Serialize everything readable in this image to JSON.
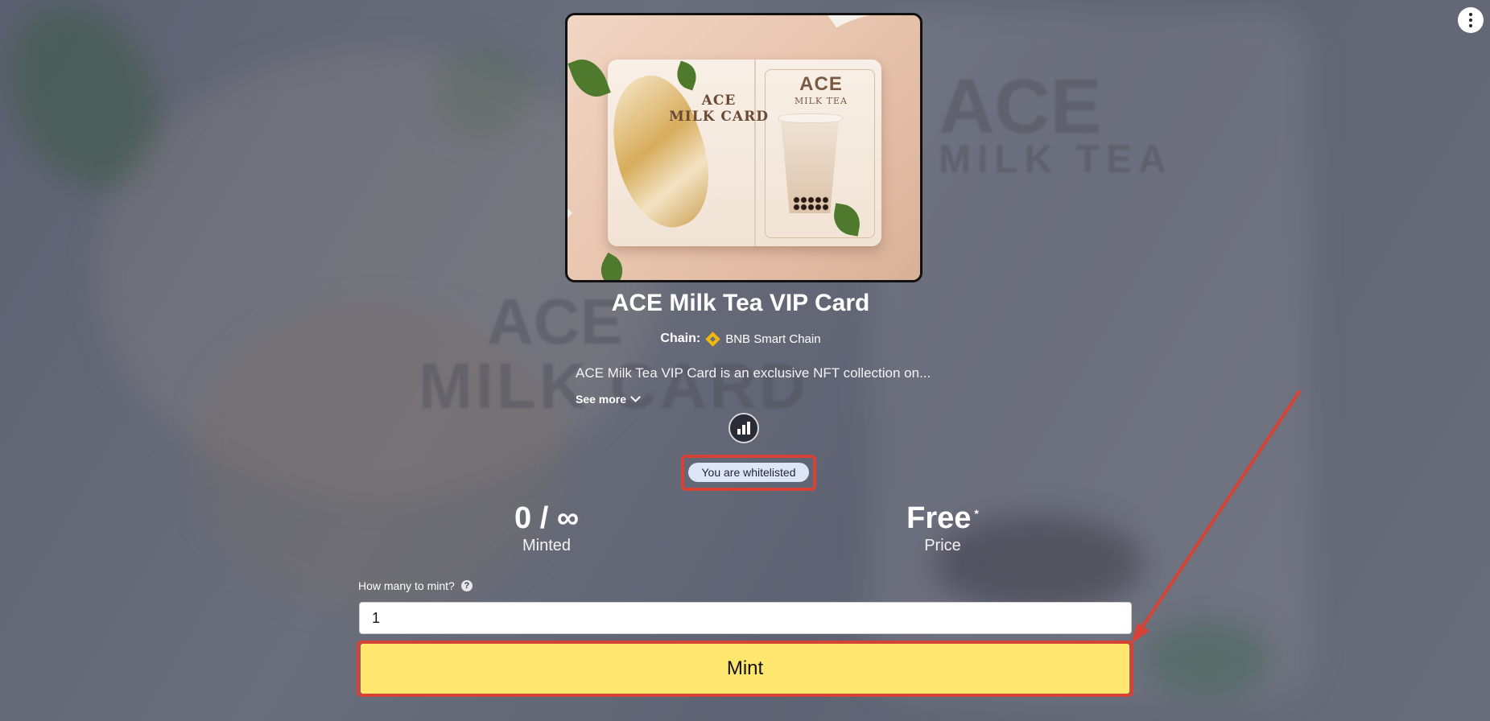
{
  "collection": {
    "title": "ACE Milk Tea VIP Card",
    "chain_label": "Chain:",
    "chain_name": "BNB Smart Chain",
    "description": "ACE Milk Tea VIP Card is an exclusive NFT collection on...",
    "see_more": "See more"
  },
  "artwork": {
    "card_text_line1": "ACE",
    "card_text_line2": "MILK CARD",
    "brand": "ACE",
    "brand_sub": "MILK TEA"
  },
  "whitelist": {
    "badge": "You are whitelisted"
  },
  "stats": {
    "minted_value": "0 / ∞",
    "minted_label": "Minted",
    "price_value": "Free",
    "price_marker": "*",
    "price_label": "Price"
  },
  "mint_form": {
    "quantity_label": "How many to mint?",
    "help_glyph": "?",
    "quantity_value": "1",
    "mint_button": "Mint"
  },
  "icons": {
    "menu": "more-vertical-icon",
    "chain": "bnb-icon",
    "chevron": "chevron-down-icon",
    "help": "question-icon",
    "logo": "creator-logo-icon"
  },
  "colors": {
    "mint_button": "#ffe66e",
    "highlight": "#d64235",
    "whitelist_pill": "#dde6f6"
  }
}
